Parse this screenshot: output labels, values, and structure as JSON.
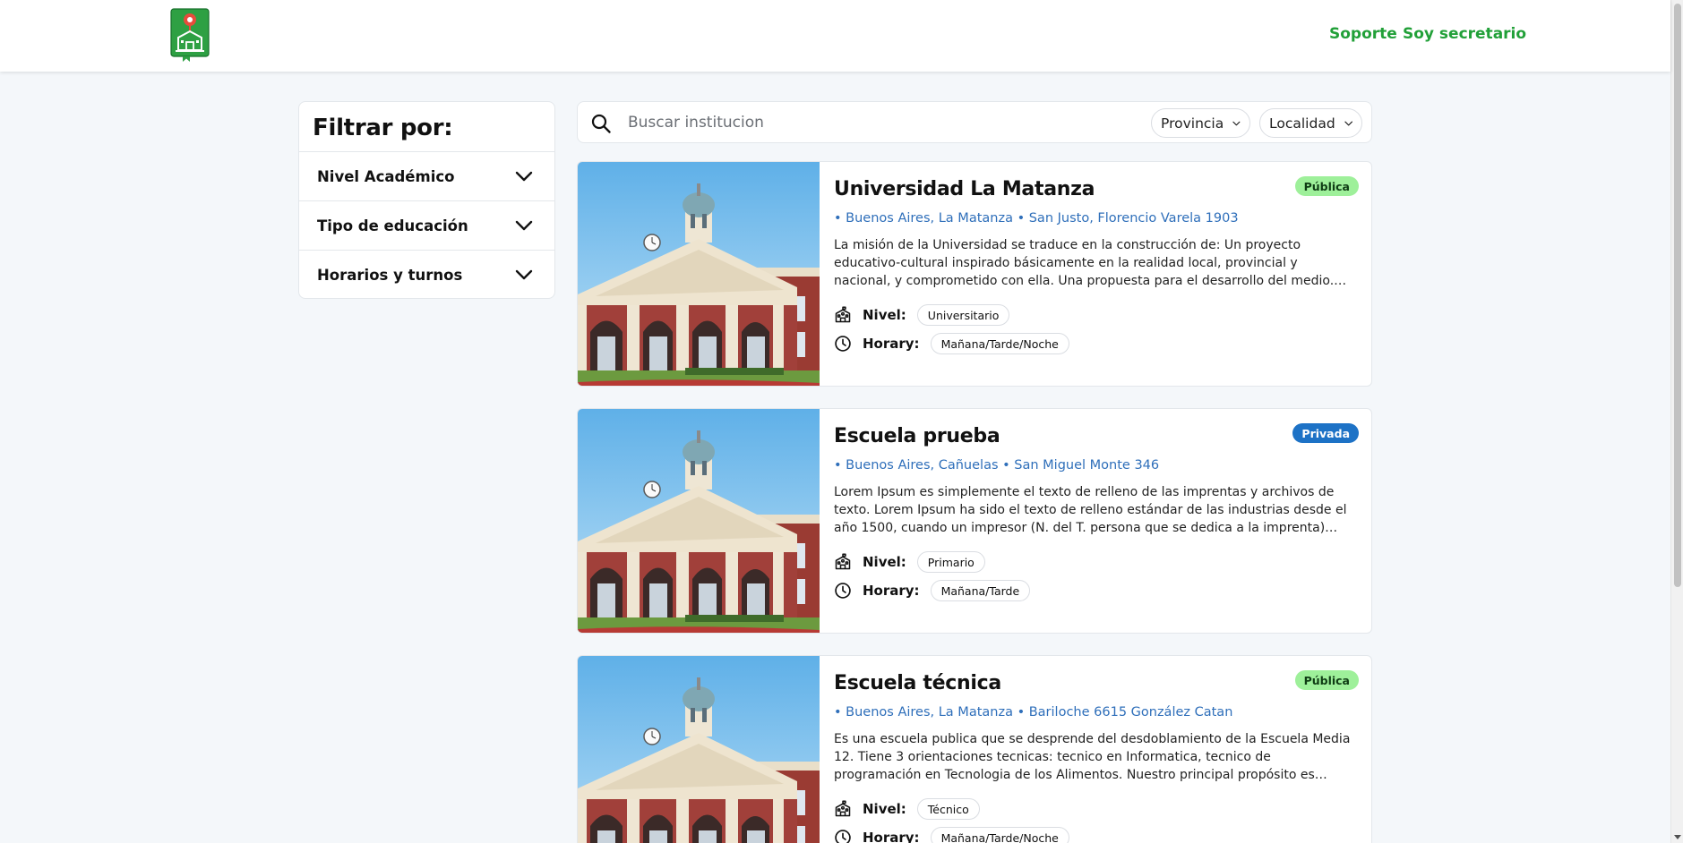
{
  "header": {
    "logo_icon": "school-map-pin-logo-icon",
    "nav": [
      {
        "label": "Soporte"
      },
      {
        "label": "Soy secretario"
      }
    ]
  },
  "filters": {
    "title": "Filtrar por:",
    "items": [
      {
        "label": "Nivel Académico"
      },
      {
        "label": "Tipo de educación"
      },
      {
        "label": "Horarios y turnos"
      }
    ]
  },
  "search": {
    "placeholder": "Buscar institucion",
    "value": "",
    "provincia_label": "Provincia",
    "localidad_label": "Localidad"
  },
  "labels": {
    "nivel": "Nivel:",
    "horario": "Horary:"
  },
  "institutions": [
    {
      "name": "Universidad La Matanza",
      "type": "Pública",
      "location": "• Buenos Aires, La Matanza • San Justo, Florencio Varela 1903",
      "description": "La misión de la Universidad se traduce en la construcción de: Un proyecto educativo-cultural inspirado básicamente en la realidad local, provincial y nacional, y comprometido con ella. Una propuesta para el desarrollo del medio. Una iniciativa…",
      "nivel": "Universitario",
      "horario": "Mañana/Tarde/Noche"
    },
    {
      "name": "Escuela prueba",
      "type": "Privada",
      "location": "• Buenos Aires, Cañuelas • San Miguel Monte 346",
      "description": "Lorem Ipsum es simplemente el texto de relleno de las imprentas y archivos de texto. Lorem Ipsum ha sido el texto de relleno estándar de las industrias desde el año 1500, cuando un impresor (N. del T. persona que se dedica a la imprenta) desconocido us…",
      "nivel": "Primario",
      "horario": "Mañana/Tarde"
    },
    {
      "name": "Escuela técnica",
      "type": "Pública",
      "location": "• Buenos Aires, La Matanza • Bariloche 6615 González Catan",
      "description": "Es una escuela publica que se desprende del desdoblamiento de la Escuela Media 12. Tiene 3 orientaciones tecnicas: tecnico en Informatica, tecnico de programación en Tecnologia de los Alimentos. Nuestro principal propósito es contribuir para lograr un…",
      "nivel": "Técnico",
      "horario": "Mañana/Tarde/Noche"
    }
  ],
  "colors": {
    "brand_green": "#21a038",
    "badge_publica": "#9ef09a",
    "badge_privada": "#1d72c6",
    "location_blue": "#2f6fba",
    "page_bg": "#f4f7fa"
  }
}
